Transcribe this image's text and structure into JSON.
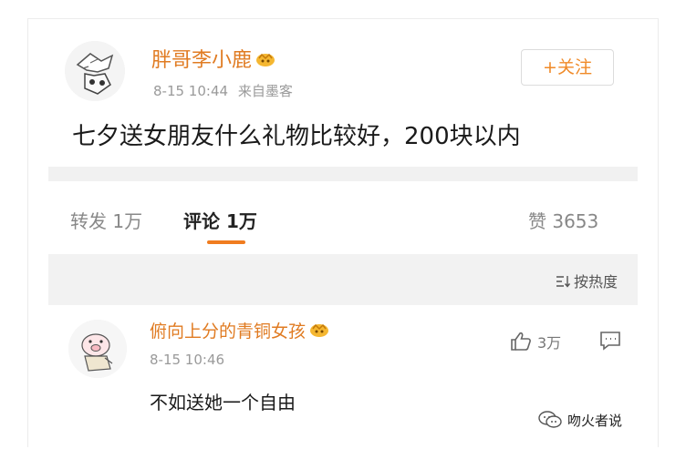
{
  "post": {
    "author": "胖哥李小鹿",
    "time": "8-15 10:44",
    "source": "来自墨客",
    "follow_label": "+关注",
    "content": "七夕送女朋友什么礼物比较好，200块以内"
  },
  "tabs": {
    "repost": "转发 1万",
    "comment": "评论 1万",
    "like": "赞 3653"
  },
  "sort": {
    "label": "按热度"
  },
  "comment": {
    "author": "俯向上分的青铜女孩",
    "time": "8-15 10:46",
    "text": "不如送她一个自由",
    "likes": "3万"
  },
  "watermark": {
    "text": "吻火者说"
  },
  "colors": {
    "accent": "#e07b22",
    "follow": "#f08a28",
    "underline": "#f07c1f"
  },
  "icons": [
    "vip-crown-icon",
    "sort-icon",
    "thumbs-up-icon",
    "comment-icon",
    "wechat-icon"
  ]
}
